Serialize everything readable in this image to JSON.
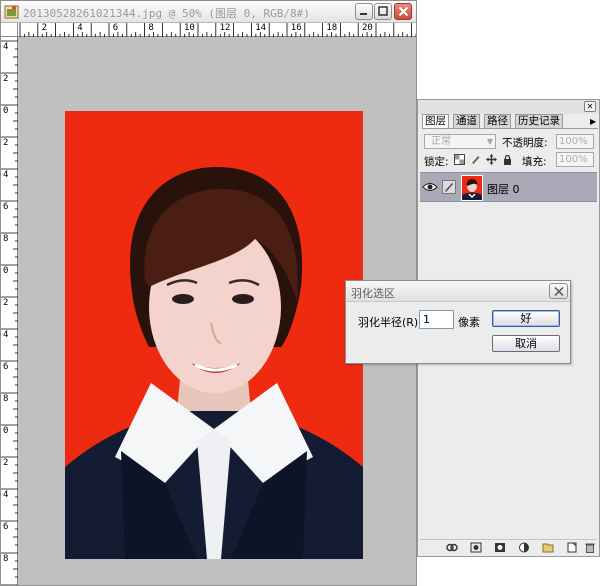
{
  "document": {
    "title": "20130528261021344.jpg @ 50% (图层 0, RGB/8#)",
    "ruler_top_labels": [
      "2",
      "4",
      "6",
      "8",
      "10",
      "12",
      "14",
      "16",
      "18",
      "20"
    ],
    "ruler_left_labels": [
      "4",
      "2",
      "0",
      "2",
      "4",
      "6",
      "8",
      "0",
      "2",
      "4",
      "6",
      "8",
      "0",
      "2",
      "4",
      "6",
      "8"
    ]
  },
  "layers_panel": {
    "tabs": [
      "图层",
      "通道",
      "路径",
      "历史记录"
    ],
    "blend_mode": "正常",
    "opacity_label": "不透明度:",
    "opacity_value": "100%",
    "lock_label": "锁定:",
    "fill_label": "填充:",
    "fill_value": "100%",
    "layer_name": "图层 0"
  },
  "dialog": {
    "title": "羽化选区",
    "radius_label": "羽化半径(R):",
    "radius_value": "1",
    "unit": "像素",
    "ok_label": "好",
    "cancel_label": "取消"
  },
  "colors": {
    "photo_background": "#ee2b10",
    "canvas_gray": "#c0c0c0",
    "layer_selected": "#a9a9b7"
  }
}
